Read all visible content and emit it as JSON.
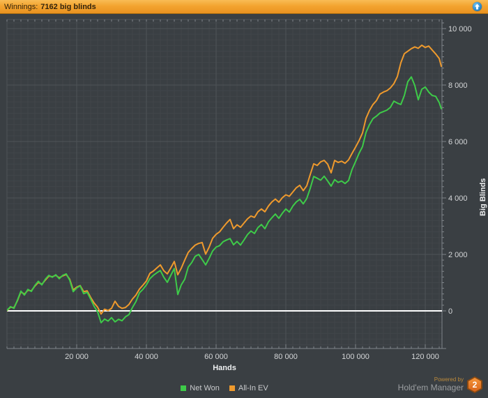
{
  "header": {
    "label": "Winnings:",
    "value": "7162 big blinds"
  },
  "axes_titles": {
    "x": "Hands",
    "y": "Big Blinds"
  },
  "legend": {
    "items": [
      {
        "label": "Net Won",
        "color": "#3ecb49"
      },
      {
        "label": "All-In EV",
        "color": "#ef9a2d"
      }
    ]
  },
  "footer_brand": {
    "powered_by": "Powered by",
    "name": "Hold'em Manager",
    "badge": "2"
  },
  "colors": {
    "background": "#3a3f43",
    "grid_minor": "#41464a",
    "grid_major": "#4e5357",
    "axis_line": "#80868b",
    "tick_label": "#d4d6d8",
    "zero_line": "#ffffff",
    "net_won": "#3ecb49",
    "all_in_ev": "#ef9a2d",
    "header_bar": "#f3a430"
  },
  "chart_data": {
    "type": "line",
    "title": "Winnings: 7162 big blinds",
    "xlabel": "Hands",
    "ylabel": "Big Blinds",
    "xlim": [
      0,
      124800
    ],
    "ylim": [
      -1400,
      10350
    ],
    "grid": {
      "minor_x_step": 2000,
      "major_x_step": 20000,
      "minor_y_step": 200,
      "major_y_step": 2000
    },
    "legend_position": "bottom-center",
    "zero_line": 0,
    "x_ticks": {
      "values": [
        20000,
        40000,
        60000,
        80000,
        100000,
        120000
      ],
      "labels": [
        "20 000",
        "40 000",
        "60 000",
        "80 000",
        "100 000",
        "120 000"
      ]
    },
    "y_ticks": {
      "values": [
        0,
        2000,
        4000,
        6000,
        8000,
        10000
      ],
      "labels": [
        "0",
        "2 000",
        "4 000",
        "6 000",
        "8 000",
        "10 000"
      ]
    },
    "x": [
      0,
      1000,
      2000,
      3000,
      4000,
      5000,
      6000,
      7000,
      8000,
      9000,
      10000,
      11000,
      12000,
      13000,
      14000,
      15000,
      16000,
      17000,
      18000,
      19000,
      20000,
      21000,
      22000,
      23000,
      24000,
      25000,
      26000,
      27000,
      28000,
      29000,
      30000,
      31000,
      32000,
      33000,
      34000,
      35000,
      36000,
      37000,
      38000,
      39000,
      40000,
      41000,
      42000,
      43000,
      44000,
      45000,
      46000,
      47000,
      48000,
      49000,
      50000,
      51000,
      52000,
      53000,
      54000,
      55000,
      56000,
      57000,
      58000,
      59000,
      60000,
      61000,
      62000,
      63000,
      64000,
      65000,
      66000,
      67000,
      68000,
      69000,
      70000,
      71000,
      72000,
      73000,
      74000,
      75000,
      76000,
      77000,
      78000,
      79000,
      80000,
      81000,
      82000,
      83000,
      84000,
      85000,
      86000,
      87000,
      88000,
      89000,
      90000,
      91000,
      92000,
      93000,
      94000,
      95000,
      96000,
      97000,
      98000,
      99000,
      100000,
      101000,
      102000,
      103000,
      104000,
      105000,
      106000,
      107000,
      108000,
      109000,
      110000,
      111000,
      112000,
      113000,
      114000,
      115000,
      116000,
      117000,
      118000,
      119000,
      120000,
      121000,
      122000,
      123000,
      124000,
      124600
    ],
    "series": [
      {
        "name": "All-In EV",
        "color": "#ef9a2d",
        "values": [
          10,
          130,
          110,
          360,
          680,
          590,
          730,
          710,
          880,
          1010,
          940,
          1090,
          1230,
          1210,
          1260,
          1170,
          1240,
          1290,
          1120,
          740,
          840,
          900,
          680,
          710,
          480,
          280,
          130,
          -110,
          60,
          10,
          90,
          340,
          160,
          90,
          120,
          230,
          420,
          560,
          770,
          910,
          1060,
          1330,
          1410,
          1520,
          1630,
          1420,
          1310,
          1520,
          1750,
          1280,
          1510,
          1800,
          2070,
          2210,
          2330,
          2390,
          2420,
          2010,
          2260,
          2570,
          2710,
          2800,
          2960,
          3110,
          3240,
          2910,
          3050,
          2960,
          3110,
          3260,
          3360,
          3310,
          3510,
          3610,
          3510,
          3710,
          3860,
          3960,
          3850,
          4010,
          4110,
          4060,
          4210,
          4360,
          4450,
          4260,
          4430,
          4830,
          5210,
          5150,
          5280,
          5330,
          5200,
          4890,
          5330,
          5260,
          5300,
          5230,
          5350,
          5580,
          5800,
          6030,
          6300,
          6820,
          7100,
          7310,
          7450,
          7680,
          7750,
          7800,
          7900,
          8050,
          8300,
          8790,
          9110,
          9200,
          9290,
          9350,
          9300,
          9410,
          9330,
          9380,
          9240,
          9100,
          8940,
          8665
        ]
      },
      {
        "name": "Net Won",
        "color": "#3ecb49",
        "values": [
          20,
          150,
          90,
          380,
          700,
          560,
          760,
          690,
          900,
          1050,
          920,
          1120,
          1260,
          1190,
          1280,
          1140,
          1260,
          1310,
          1090,
          680,
          810,
          890,
          610,
          660,
          420,
          160,
          -30,
          -420,
          -290,
          -360,
          -240,
          -390,
          -300,
          -350,
          -210,
          -130,
          120,
          330,
          640,
          760,
          920,
          1140,
          1260,
          1350,
          1430,
          1190,
          1010,
          1260,
          1500,
          580,
          920,
          1120,
          1550,
          1710,
          1930,
          2000,
          1820,
          1630,
          1860,
          2120,
          2260,
          2310,
          2450,
          2510,
          2560,
          2340,
          2460,
          2330,
          2510,
          2700,
          2830,
          2740,
          2950,
          3060,
          2910,
          3150,
          3300,
          3430,
          3280,
          3460,
          3610,
          3500,
          3710,
          3860,
          3950,
          3790,
          3980,
          4340,
          4760,
          4700,
          4630,
          4770,
          4600,
          4420,
          4650,
          4550,
          4600,
          4510,
          4620,
          5010,
          5290,
          5580,
          5820,
          6320,
          6600,
          6810,
          6900,
          7010,
          7060,
          7110,
          7210,
          7430,
          7360,
          7310,
          7630,
          8120,
          8290,
          7980,
          7480,
          7850,
          7930,
          7750,
          7630,
          7600,
          7380,
          7162
        ]
      }
    ]
  }
}
